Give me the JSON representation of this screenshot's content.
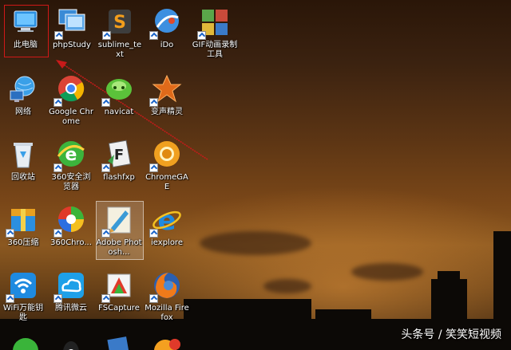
{
  "desktop": {
    "icons": [
      {
        "label": "此电脑",
        "icon": "computer-icon"
      },
      {
        "label": "phpStudy",
        "icon": "phpstudy-icon"
      },
      {
        "label": "sublime_text",
        "icon": "sublime-icon"
      },
      {
        "label": "iDo",
        "icon": "ido-icon"
      },
      {
        "label": "GIF动画录制工具",
        "icon": "gif-recorder-icon"
      },
      {
        "label": "网络",
        "icon": "network-icon"
      },
      {
        "label": "Google Chrome",
        "icon": "chrome-icon"
      },
      {
        "label": "navicat",
        "icon": "navicat-icon"
      },
      {
        "label": "变声精灵",
        "icon": "voice-changer-icon"
      },
      {
        "label": "回收站",
        "icon": "recycle-bin-icon"
      },
      {
        "label": "360安全浏览器",
        "icon": "360-browser-icon"
      },
      {
        "label": "flashfxp",
        "icon": "flashfxp-icon"
      },
      {
        "label": "ChromeGAE",
        "icon": "chromegae-icon"
      },
      {
        "label": "360压缩",
        "icon": "360-zip-icon"
      },
      {
        "label": "360Chro...",
        "icon": "360-chrome-icon"
      },
      {
        "label": "Adobe Photosh...",
        "icon": "photoshop-icon"
      },
      {
        "label": "iexplore",
        "icon": "ie-icon"
      },
      {
        "label": "WiFi万能钥匙",
        "icon": "wifi-key-icon"
      },
      {
        "label": "腾讯微云",
        "icon": "weiyun-icon"
      },
      {
        "label": "FSCapture",
        "icon": "fscapture-icon"
      },
      {
        "label": "Mozilla Firefox",
        "icon": "firefox-icon"
      }
    ]
  },
  "watermark": "头条号 / 笑笑短视频",
  "colors": {
    "selection_red": "#d01818",
    "arrow_red": "#c81a1a"
  }
}
